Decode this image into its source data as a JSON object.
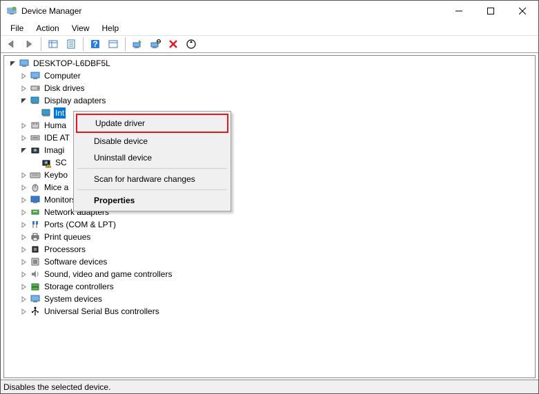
{
  "window": {
    "title": "Device Manager"
  },
  "menu": {
    "file": "File",
    "action": "Action",
    "view": "View",
    "help": "Help"
  },
  "tree": {
    "root": "DESKTOP-L6DBF5L",
    "nodes": {
      "computer": "Computer",
      "disk_drives": "Disk drives",
      "display_adapters": "Display adapters",
      "display_child": "Int",
      "human_interface": "Huma",
      "ide_ata": "IDE AT",
      "imaging": "Imagi",
      "imaging_child": "SC",
      "keyboards": "Keybo",
      "mice": "Mice a",
      "monitors": "Monitors",
      "network": "Network adapters",
      "ports": "Ports (COM & LPT)",
      "print_queues": "Print queues",
      "processors": "Processors",
      "software_devices": "Software devices",
      "sound": "Sound, video and game controllers",
      "storage": "Storage controllers",
      "system": "System devices",
      "usb": "Universal Serial Bus controllers"
    }
  },
  "context_menu": {
    "update_driver": "Update driver",
    "disable_device": "Disable device",
    "uninstall_device": "Uninstall device",
    "scan_hardware": "Scan for hardware changes",
    "properties": "Properties"
  },
  "statusbar": {
    "text": "Disables the selected device."
  }
}
